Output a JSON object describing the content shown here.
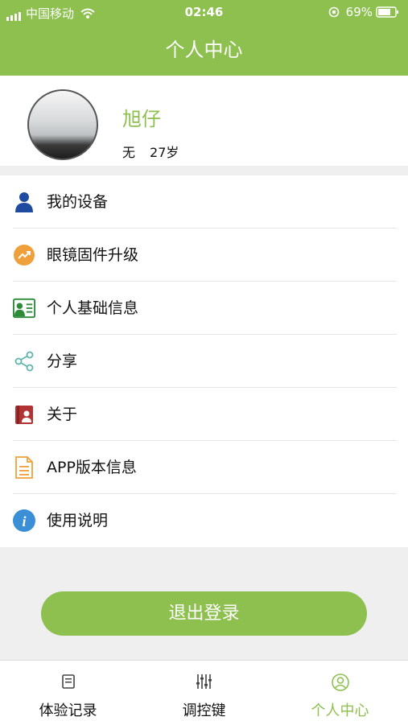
{
  "status_bar": {
    "carrier": "中国移动",
    "time": "02:46",
    "battery": "69%"
  },
  "header": {
    "title": "个人中心"
  },
  "profile": {
    "name": "旭仔",
    "field1": "无",
    "age": "27岁"
  },
  "menu": [
    {
      "label": "我的设备",
      "icon": "user-icon"
    },
    {
      "label": "眼镜固件升级",
      "icon": "trend-up-icon"
    },
    {
      "label": "个人基础信息",
      "icon": "id-card-icon"
    },
    {
      "label": "分享",
      "icon": "share-icon"
    },
    {
      "label": "关于",
      "icon": "book-icon"
    },
    {
      "label": "APP版本信息",
      "icon": "document-icon"
    },
    {
      "label": "使用说明",
      "icon": "info-icon"
    }
  ],
  "logout_label": "退出登录",
  "tabs": [
    {
      "label": "体验记录",
      "icon": "record-icon"
    },
    {
      "label": "调控键",
      "icon": "sliders-icon"
    },
    {
      "label": "个人中心",
      "icon": "person-circle-icon"
    }
  ],
  "colors": {
    "accent": "#8dc04f",
    "background": "#efefef"
  }
}
